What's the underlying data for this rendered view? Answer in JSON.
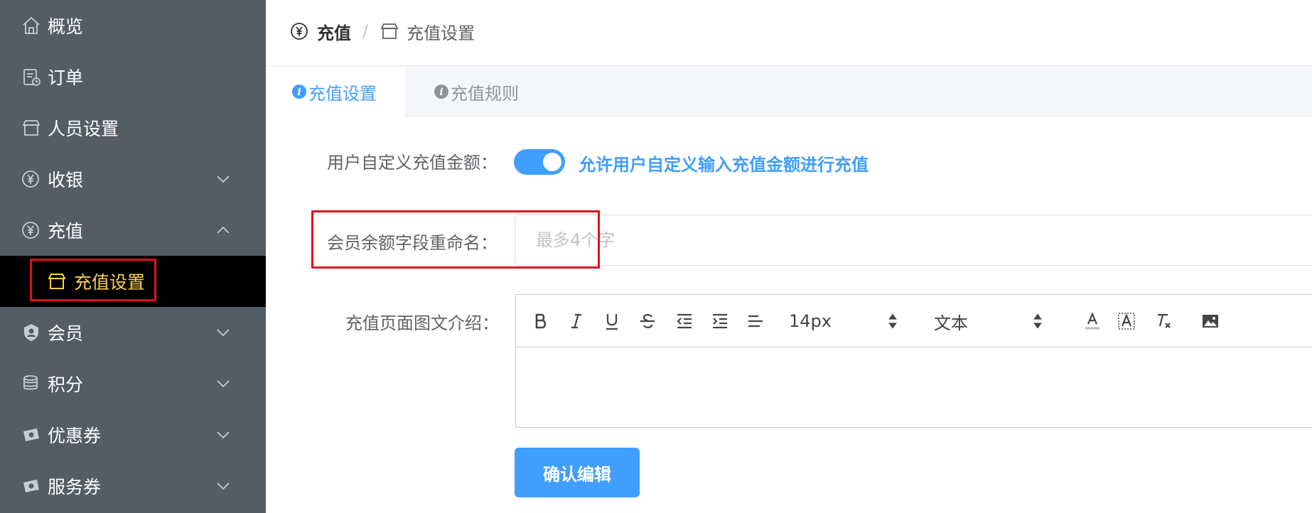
{
  "sidebar": {
    "items": [
      {
        "label": "概览",
        "icon": "home-icon",
        "expandable": false
      },
      {
        "label": "订单",
        "icon": "order-icon",
        "expandable": false
      },
      {
        "label": "人员设置",
        "icon": "store-icon",
        "expandable": false
      },
      {
        "label": "收银",
        "icon": "yen-coin-icon",
        "expandable": true,
        "expanded": false
      },
      {
        "label": "充值",
        "icon": "yen-coin-icon",
        "expandable": true,
        "expanded": true
      },
      {
        "label": "充值设置",
        "icon": "store-icon",
        "active": true,
        "submenu": true
      },
      {
        "label": "会员",
        "icon": "member-badge-icon",
        "expandable": true,
        "expanded": false
      },
      {
        "label": "积分",
        "icon": "coins-stack-icon",
        "expandable": true,
        "expanded": false
      },
      {
        "label": "优惠券",
        "icon": "ticket-icon",
        "expandable": true,
        "expanded": false
      },
      {
        "label": "服务券",
        "icon": "ticket-icon",
        "expandable": true,
        "expanded": false
      }
    ],
    "bg_color": "#545c64",
    "active_text_color": "#ffd04b"
  },
  "breadcrumb": {
    "parent": "充值",
    "separator": "/",
    "current": "充值设置"
  },
  "tabs": [
    {
      "label": "充值设置",
      "active": true
    },
    {
      "label": "充值规则",
      "active": false
    }
  ],
  "form": {
    "custom_amount": {
      "label": "用户自定义充值金额：",
      "enabled": true,
      "description": "允许用户自定义输入充值金额进行充值"
    },
    "balance_rename": {
      "label": "会员余额字段重命名：",
      "value": "",
      "placeholder": "最多4个字"
    },
    "intro": {
      "label": "充值页面图文介绍：",
      "font_size": "14px",
      "block_type": "文本"
    },
    "confirm_label": "确认编辑"
  },
  "accent_color": "#409eff",
  "highlight_color": "#e0101e"
}
